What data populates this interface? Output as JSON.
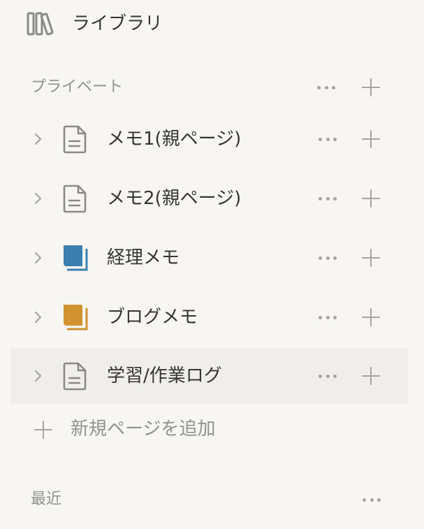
{
  "library": {
    "icon": "library-icon",
    "label": "ライブラリ"
  },
  "private_section": {
    "label": "プライベート",
    "more_icon": "more-horizontal-icon",
    "add_icon": "plus-icon"
  },
  "pages": [
    {
      "title": "メモ1(親ページ)",
      "icon": "document-icon",
      "icon_color": "#8a8985",
      "selected": false
    },
    {
      "title": "メモ2(親ページ)",
      "icon": "document-icon",
      "icon_color": "#8a8985",
      "selected": false
    },
    {
      "title": "経理メモ",
      "icon": "book-icon",
      "icon_color": "#3b7fb0",
      "selected": false
    },
    {
      "title": "ブログメモ",
      "icon": "book-icon",
      "icon_color": "#d1932f",
      "selected": false
    },
    {
      "title": "学習/作業ログ",
      "icon": "document-icon",
      "icon_color": "#8a8985",
      "selected": true
    }
  ],
  "add_page": {
    "icon": "plus-icon",
    "label": "新規ページを追加"
  },
  "recent_section": {
    "label": "最近",
    "more_icon": "more-horizontal-icon"
  },
  "colors": {
    "background": "#f7f6f3",
    "selected_row": "#efeeeb",
    "text": "#37352f",
    "muted": "#91918e",
    "icon_gray": "#a5a49f"
  }
}
